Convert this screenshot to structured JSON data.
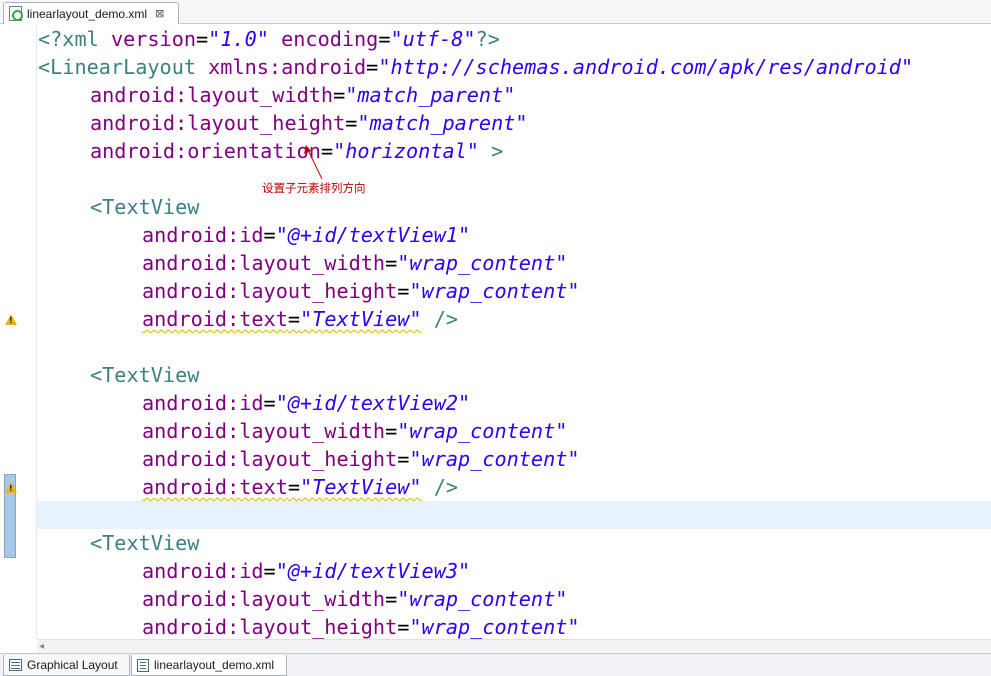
{
  "editor_tab": {
    "label": "linearlayout_demo.xml",
    "close_glyph": "⊠"
  },
  "code": {
    "l1": {
      "pi_open": "<?xml ",
      "a1": "version",
      "eq1": "=",
      "v1": "\"1.0\"",
      "sp": " ",
      "a2": "encoding",
      "eq2": "=",
      "v2": "\"utf-8\"",
      "pi_close": "?>"
    },
    "l2": {
      "tag": "<LinearLayout ",
      "attr": "xmlns:android",
      "eq": "=",
      "val": "\"http://schemas.android.com/apk/res/android\""
    },
    "l3": {
      "attr": "android:layout_width",
      "eq": "=",
      "val": "\"match_parent\""
    },
    "l4": {
      "attr": "android:layout_height",
      "eq": "=",
      "val": "\"match_parent\""
    },
    "l5": {
      "attr": "android:orientation",
      "eq": "=",
      "val": "\"horizontal\"",
      "close": " >"
    },
    "tv1": {
      "tag": "<TextView",
      "id_attr": "android:id",
      "id_val": "\"@+id/textView1\"",
      "w_attr": "android:layout_width",
      "w_val": "\"wrap_content\"",
      "h_attr": "android:layout_height",
      "h_val": "\"wrap_content\"",
      "t_attr": "android:text",
      "t_val": "\"TextView\"",
      "t_close": " />",
      "eq": "="
    },
    "tv2": {
      "tag": "<TextView",
      "id_attr": "android:id",
      "id_val": "\"@+id/textView2\"",
      "w_attr": "android:layout_width",
      "w_val": "\"wrap_content\"",
      "h_attr": "android:layout_height",
      "h_val": "\"wrap_content\"",
      "t_attr": "android:text",
      "t_val": "\"TextView\"",
      "t_close": " />",
      "eq": "="
    },
    "tv3": {
      "tag": "<TextView",
      "id_attr": "android:id",
      "id_val": "\"@+id/textView3\"",
      "w_attr": "android:layout_width",
      "w_val": "\"wrap_content\"",
      "h_attr": "android:layout_height",
      "h_val": "\"wrap_content\"",
      "eq": "="
    }
  },
  "annotation": "设置子元素排列方向",
  "bottom_tabs": [
    {
      "label": "Graphical Layout"
    },
    {
      "label": "linearlayout_demo.xml"
    }
  ],
  "colors": {
    "tag": "#3f7f7f",
    "attribute": "#7f007f",
    "value": "#2a00ff",
    "annotation": "#c00000",
    "current_line": "#e8f2fe"
  }
}
